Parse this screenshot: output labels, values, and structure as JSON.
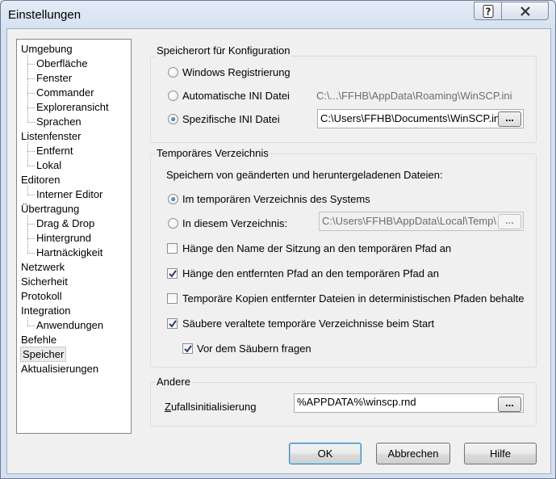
{
  "window": {
    "title": "Einstellungen"
  },
  "caption_buttons": {
    "help_icon": "question-icon",
    "close_icon": "close-icon"
  },
  "tree": {
    "items": [
      {
        "label": "Umgebung",
        "level": 0
      },
      {
        "label": "Oberfläche",
        "level": 1
      },
      {
        "label": "Fenster",
        "level": 1
      },
      {
        "label": "Commander",
        "level": 1
      },
      {
        "label": "Exploreransicht",
        "level": 1
      },
      {
        "label": "Sprachen",
        "level": 1
      },
      {
        "label": "Listenfenster",
        "level": 0
      },
      {
        "label": "Entfernt",
        "level": 1
      },
      {
        "label": "Lokal",
        "level": 1
      },
      {
        "label": "Editoren",
        "level": 0
      },
      {
        "label": "Interner Editor",
        "level": 1
      },
      {
        "label": "Übertragung",
        "level": 0
      },
      {
        "label": "Drag & Drop",
        "level": 1
      },
      {
        "label": "Hintergrund",
        "level": 1
      },
      {
        "label": "Hartnäckigkeit",
        "level": 1
      },
      {
        "label": "Netzwerk",
        "level": 0
      },
      {
        "label": "Sicherheit",
        "level": 0
      },
      {
        "label": "Protokoll",
        "level": 0
      },
      {
        "label": "Integration",
        "level": 0
      },
      {
        "label": "Anwendungen",
        "level": 1
      },
      {
        "label": "Befehle",
        "level": 0
      },
      {
        "label": "Speicher",
        "level": 0,
        "selected": true
      },
      {
        "label": "Aktualisierungen",
        "level": 0
      }
    ]
  },
  "config_location": {
    "title": "Speicherort für Konfiguration",
    "registry_label": "Windows Registrierung",
    "auto_ini_label": "Automatische INI Datei",
    "auto_ini_path": "C:\\...\\FFHB\\AppData\\Roaming\\WinSCP.ini",
    "specific_ini_label": "Spezifische INI Datei",
    "specific_ini_value": "C:\\Users\\FFHB\\Documents\\WinSCP.ini",
    "browse_label": "...",
    "selected": "specific"
  },
  "temp_dir": {
    "title": "Temporäres Verzeichnis",
    "description": "Speichern von geänderten und heruntergeladenen Dateien:",
    "system_temp_label": "Im temporären Verzeichnis des Systems",
    "custom_dir_label": "In diesem Verzeichnis:",
    "custom_dir_value": "C:\\Users\\FFHB\\AppData\\Local\\Temp\\",
    "browse_label": "...",
    "append_session_label": "Hänge den Name der Sitzung an den temporären Pfad an",
    "append_session_checked": false,
    "append_remote_label": "Hänge den entfernten Pfad an den temporären Pfad an",
    "append_remote_checked": true,
    "deterministic_label": "Temporäre Kopien entfernter Dateien in deterministischen Pfaden behalten",
    "deterministic_checked": false,
    "cleanup_label": "Säubere veraltete temporäre Verzeichnisse beim Start",
    "cleanup_checked": true,
    "ask_label": "Vor dem Säubern fragen",
    "ask_checked": true
  },
  "other": {
    "title": "Andere",
    "random_seed_label": "Zufallsinitialisierung",
    "random_seed_value": "%APPDATA%\\winscp.rnd",
    "browse_label": "..."
  },
  "buttons": {
    "ok": "OK",
    "cancel": "Abbrechen",
    "help": "Hilfe"
  }
}
